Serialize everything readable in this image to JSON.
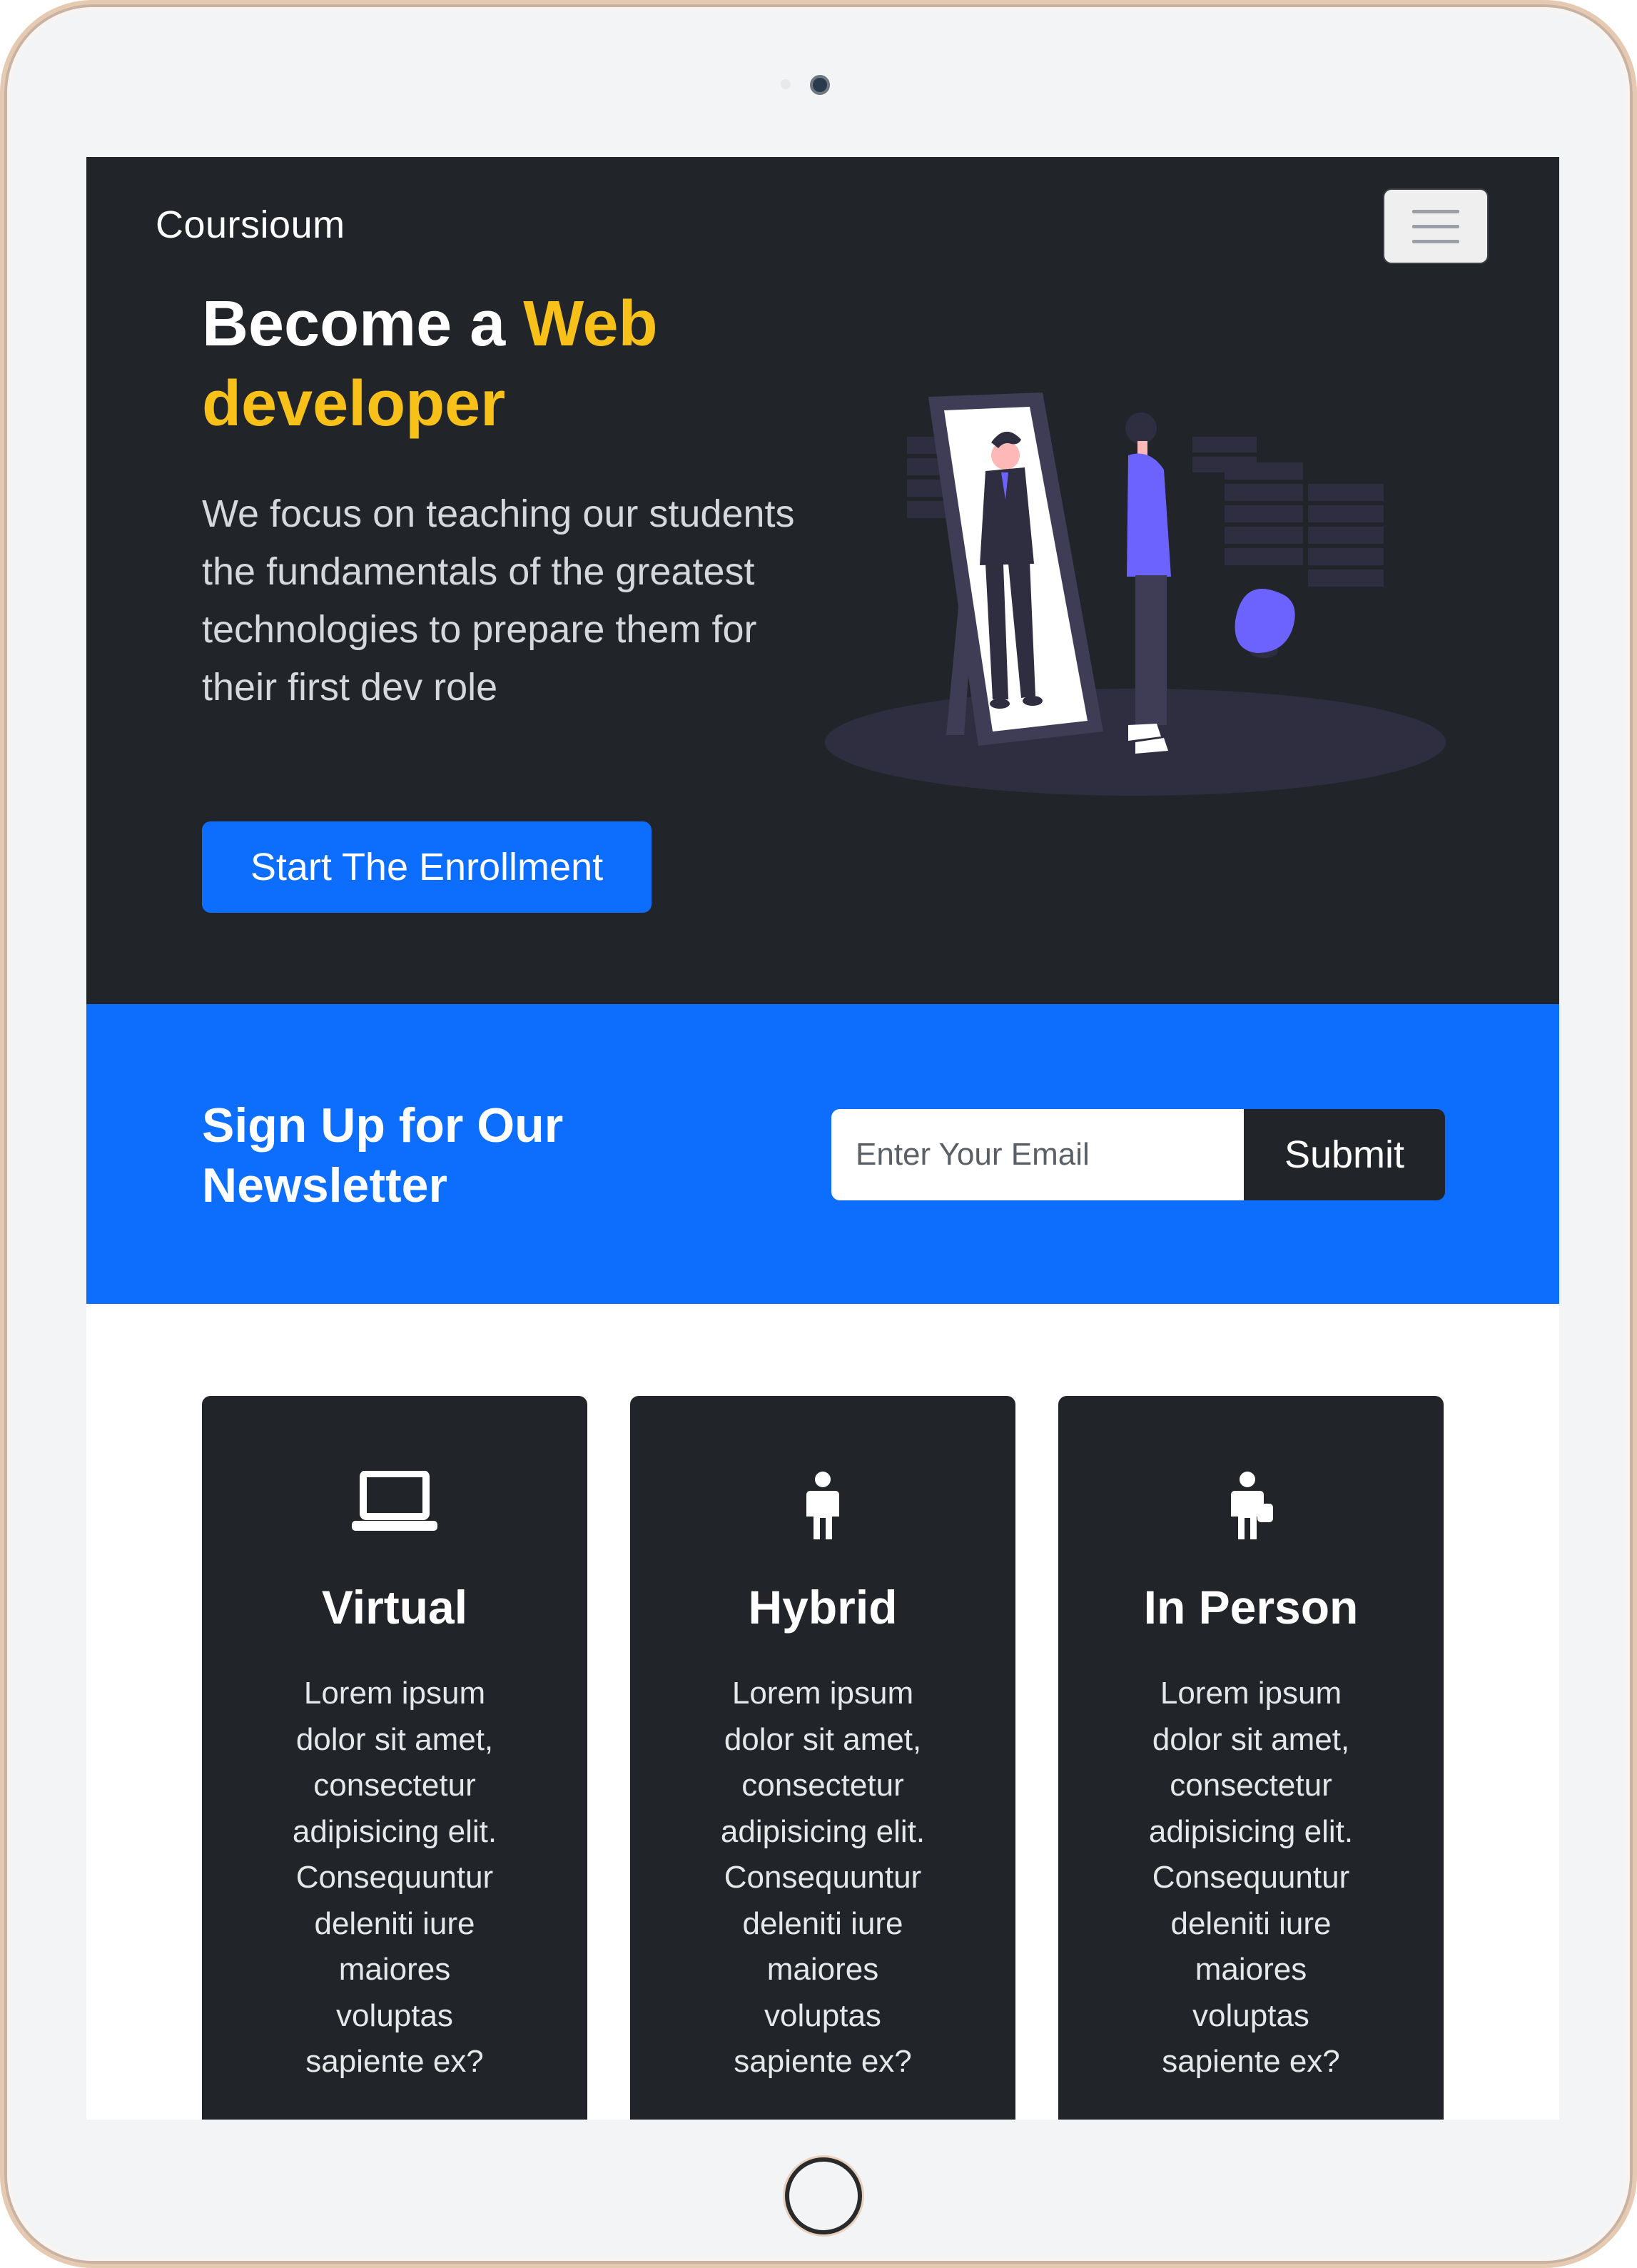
{
  "nav": {
    "brand": "Coursioum"
  },
  "hero": {
    "title_prefix": "Become a ",
    "title_accent": "Web developer",
    "text": "We focus on teaching our students the fundamentals of the greatest technologies to prepare them for their first dev role",
    "cta_label": "Start The Enrollment"
  },
  "newsletter": {
    "title": "Sign Up for Our Newsletter",
    "email_placeholder": "Enter Your Email",
    "submit_label": "Submit"
  },
  "cards": [
    {
      "title": "Virtual",
      "icon": "laptop-icon",
      "text": "Lorem ipsum dolor sit amet, consectetur adipisicing elit. Consequuntur deleniti iure maiores voluptas sapiente ex?"
    },
    {
      "title": "Hybrid",
      "icon": "person-icon",
      "text": "Lorem ipsum dolor sit amet, consectetur adipisicing elit. Consequuntur deleniti iure maiores voluptas sapiente ex?"
    },
    {
      "title": "In Person",
      "icon": "person-with-bag-icon",
      "text": "Lorem ipsum dolor sit amet, consectetur adipisicing elit. Consequuntur deleniti iure maiores voluptas sapiente ex?"
    }
  ],
  "colors": {
    "dark": "#212529",
    "primary": "#0d6efd",
    "accent": "#f7c11a",
    "illustration_purple": "#6c63ff"
  }
}
